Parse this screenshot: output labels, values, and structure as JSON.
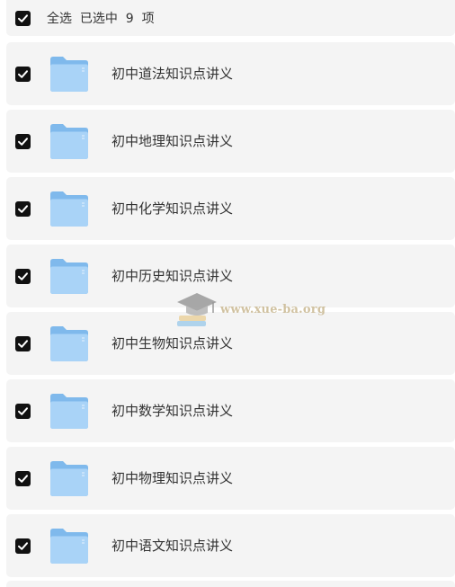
{
  "header": {
    "select_all_label": "全选",
    "selected_text": "已选中  9  项"
  },
  "items": [
    {
      "label": "初中道法知识点讲义",
      "checked": true,
      "icon": "folder-icon"
    },
    {
      "label": "初中地理知识点讲义",
      "checked": true,
      "icon": "folder-icon"
    },
    {
      "label": "初中化学知识点讲义",
      "checked": true,
      "icon": "folder-icon"
    },
    {
      "label": "初中历史知识点讲义",
      "checked": true,
      "icon": "folder-icon"
    },
    {
      "label": "初中生物知识点讲义",
      "checked": true,
      "icon": "folder-icon"
    },
    {
      "label": "初中数学知识点讲义",
      "checked": true,
      "icon": "folder-icon"
    },
    {
      "label": "初中物理知识点讲义",
      "checked": true,
      "icon": "folder-icon"
    },
    {
      "label": "初中语文知识点讲义",
      "checked": true,
      "icon": "folder-icon"
    }
  ],
  "watermark": {
    "text": "www.xue-ba.org"
  },
  "colors": {
    "row_background": "#f4f4f4",
    "checkbox": "#111111",
    "folder_back": "#7fb9ec",
    "folder_front": "#a9d3f7",
    "label": "#333333"
  }
}
